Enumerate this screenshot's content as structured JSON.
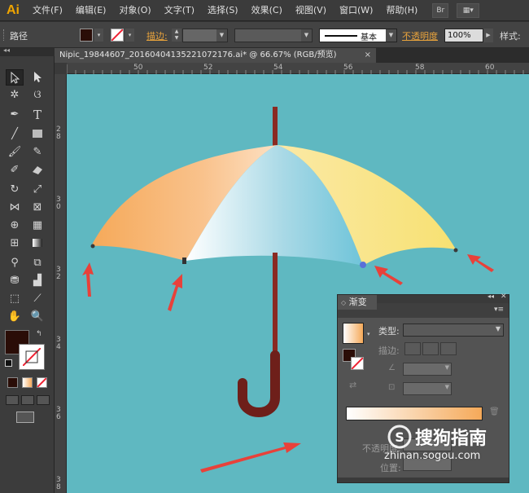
{
  "app": {
    "logo": "Ai"
  },
  "menu": [
    "文件(F)",
    "编辑(E)",
    "对象(O)",
    "文字(T)",
    "选择(S)",
    "效果(C)",
    "视图(V)",
    "窗口(W)",
    "帮助(H)"
  ],
  "menubar_buttons": [
    "Br",
    "▦▾"
  ],
  "control_bar": {
    "selection_label": "路径",
    "stroke_label": "描边:",
    "brush_label": "基本",
    "opacity_label": "不透明度",
    "opacity_value": "100%",
    "style_label": "样式:"
  },
  "document_tab": {
    "title": "Nipic_19844607_20160404135221072176.ai* @ 66.67% (RGB/预览)",
    "close": "×"
  },
  "ruler": {
    "h_labels": [
      "50",
      "52",
      "54",
      "56",
      "58",
      "60"
    ],
    "v_labels": [
      "2 8",
      "3 0",
      "3 2",
      "3 4",
      "3 6",
      "3 8"
    ]
  },
  "toolbar": {
    "collapse": "◂◂",
    "close": "×"
  },
  "gradient_panel": {
    "tab_label": "渐变",
    "collapse": "◂◂",
    "close": "✕",
    "menu": "▾≡",
    "type_label": "类型:",
    "stroke_label": "描边:",
    "opacity_label": "不透明度:",
    "position_label": "位置:",
    "gradient_start": "#ffffff",
    "gradient_end": "#f5a959"
  },
  "watermark": {
    "brand": "搜狗指南",
    "url": "zhinan.sogou.com"
  },
  "colors": {
    "canvas_bg": "#5fb8c1",
    "accent": "#e8a33c",
    "fill": "#2a0d07",
    "arrow": "#e8413a"
  }
}
